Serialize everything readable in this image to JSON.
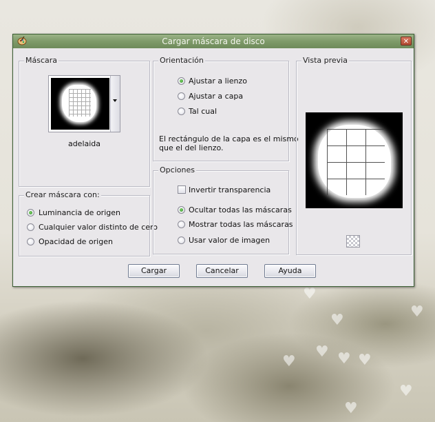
{
  "window": {
    "title": "Cargar máscara de disco"
  },
  "mascara": {
    "label": "Máscara",
    "name": "adelaida"
  },
  "orientacion": {
    "label": "Orientación",
    "options": [
      {
        "label": "Ajustar a lienzo",
        "selected": true
      },
      {
        "label": "Ajustar a capa",
        "selected": false
      },
      {
        "label": "Tal cual",
        "selected": false
      }
    ],
    "description_line1": "El rectángulo de la capa es el mismo",
    "description_line2": "que el del lienzo."
  },
  "vista_previa": {
    "label": "Vista previa"
  },
  "crear": {
    "label": "Crear máscara con:",
    "options": [
      {
        "label": "Luminancia de origen",
        "selected": true
      },
      {
        "label": "Cualquier valor distinto de cero",
        "selected": false
      },
      {
        "label": "Opacidad de origen",
        "selected": false
      }
    ]
  },
  "opciones": {
    "label": "Opciones",
    "invert_label": "Invertir transparencia",
    "invert_checked": false,
    "options": [
      {
        "label": "Ocultar todas las máscaras",
        "selected": true
      },
      {
        "label": "Mostrar todas las máscaras",
        "selected": false
      },
      {
        "label": "Usar valor de imagen",
        "selected": false
      }
    ]
  },
  "buttons": {
    "load": "Cargar",
    "cancel": "Cancelar",
    "help": "Ayuda"
  },
  "icons": {
    "app": "paint-palette-icon",
    "close": "close-icon",
    "dropdown": "dropdown-arrow-icon",
    "transparency": "transparency-grid-icon"
  }
}
